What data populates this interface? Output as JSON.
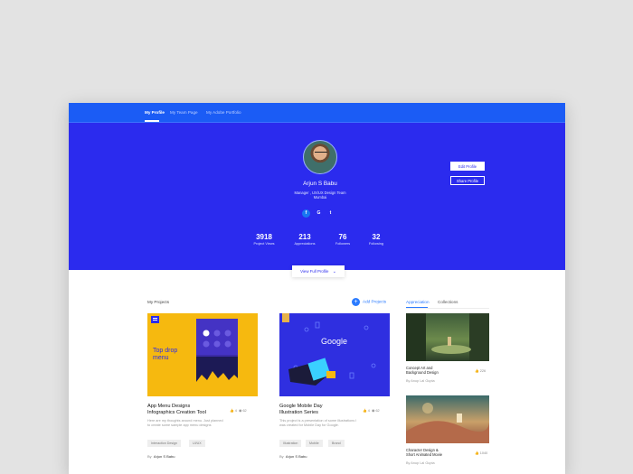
{
  "nav": {
    "tabs": [
      "My Profile",
      "My Team Page",
      "My Adobe Portfolio"
    ]
  },
  "profile": {
    "name": "Arjun S Babu",
    "role": "Manager , UX/UX Design Team",
    "location": "Mumbai",
    "social": [
      "f",
      "G",
      "t"
    ],
    "stats": [
      {
        "value": "3918",
        "label": "Project Views"
      },
      {
        "value": "213",
        "label": "Appreciations"
      },
      {
        "value": "76",
        "label": "Followers"
      },
      {
        "value": "32",
        "label": "Following"
      }
    ],
    "edit_label": "Edit Profile",
    "share_label": "Share Profile",
    "view_full_label": "View Full Profile"
  },
  "projects": {
    "section_title": "My Projects",
    "add_label": "Add Projects",
    "items": [
      {
        "title_line1": "App Menu Designs",
        "title_line2": "Infographics Creation Tool",
        "likes": "4",
        "views": "62",
        "desc": "Here are my thoughts around menu. Just planned to create some sample app menu designs",
        "tags": [
          "Interaction Design",
          "UI/UX"
        ],
        "by_prefix": "By",
        "author": "Arjun S Babu",
        "img_text": "Top drop menu"
      },
      {
        "title_line1": "Google Mobile Day",
        "title_line2": "Illustration Series",
        "likes": "4",
        "views": "62",
        "desc": "This project is a presentation of some illustrations I was created for Mobile Day for Google.",
        "tags": [
          "Illustration",
          "Mobile",
          "Brand"
        ],
        "by_prefix": "By",
        "author": "Arjun S Babu",
        "img_text": "Google"
      }
    ]
  },
  "sidebar": {
    "tabs": [
      "Appreciation",
      "Collections"
    ],
    "items": [
      {
        "title_line1": "Concept Art  and",
        "title_line2": "Background Design",
        "likes": "226",
        "by": "By  Anup Lal Gupta"
      },
      {
        "title_line1": "Character Design &",
        "title_line2": "Short Animated Movie",
        "likes": "1040",
        "by": "By  Anup Lal Gupta"
      }
    ]
  },
  "colors": {
    "hero": "#2b2bee",
    "nav": "#1b5cf5",
    "accent": "#2b7bff",
    "card_yellow": "#f6b90f"
  }
}
